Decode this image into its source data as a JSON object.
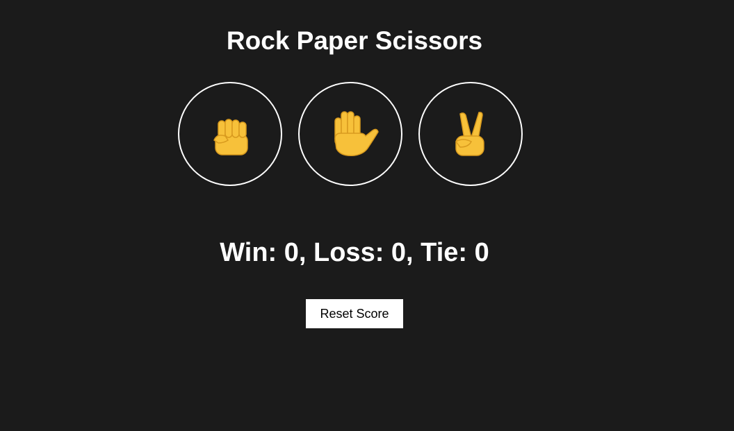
{
  "title": "Rock Paper Scissors",
  "choices": [
    {
      "id": "rock",
      "icon": "fist-icon",
      "label": "Rock"
    },
    {
      "id": "paper",
      "icon": "raised-hand-icon",
      "label": "Paper"
    },
    {
      "id": "scissors",
      "icon": "victory-hand-icon",
      "label": "Scissors"
    }
  ],
  "score": {
    "text": "Win: 0, Loss: 0, Tie: 0",
    "win": 0,
    "loss": 0,
    "tie": 0
  },
  "reset_label": "Reset Score",
  "colors": {
    "background": "#1b1b1b",
    "text": "#ffffff",
    "emoji": "#f7c13a",
    "button_bg": "#ffffff",
    "button_text": "#000000"
  }
}
